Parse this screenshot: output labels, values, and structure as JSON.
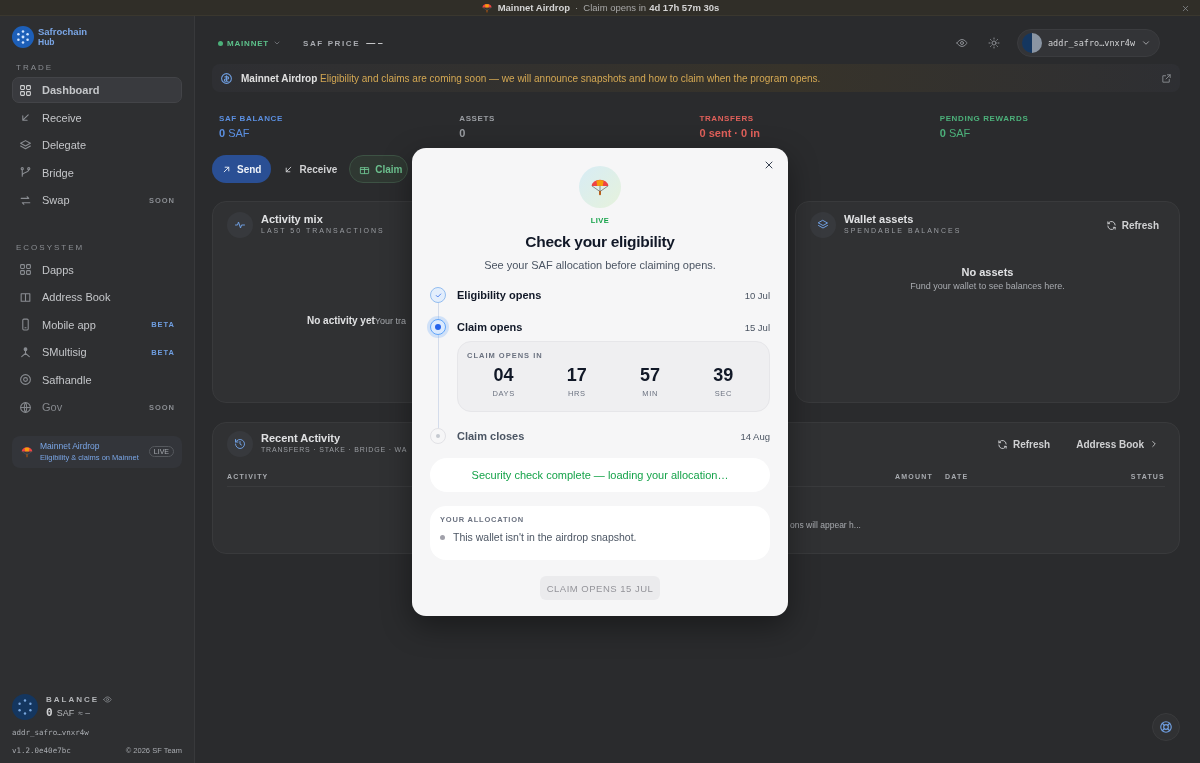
{
  "top_banner": {
    "title": "Mainnet Airdrop",
    "separator": "·",
    "label": "Claim opens in",
    "countdown": "4d 17h 57m 30s"
  },
  "sidebar": {
    "logo": {
      "name": "Safrochain",
      "sub": "Hub"
    },
    "sections": [
      {
        "title": "TRADE",
        "items": [
          {
            "label": "Dashboard",
            "selected": true,
            "disabled": false
          },
          {
            "label": "Receive",
            "selected": false,
            "disabled": false
          },
          {
            "label": "Delegate",
            "selected": false,
            "disabled": false
          },
          {
            "label": "Bridge",
            "selected": false,
            "disabled": false
          },
          {
            "label": "Swap",
            "selected": false,
            "disabled": false,
            "badge": {
              "text": "SOON",
              "kind": "soon"
            }
          }
        ]
      },
      {
        "title": "ECOSYSTEM",
        "items": [
          {
            "label": "Dapps",
            "selected": false,
            "disabled": false
          },
          {
            "label": "Address Book",
            "selected": false,
            "disabled": false
          },
          {
            "label": "Mobile app",
            "selected": false,
            "disabled": false,
            "badge": {
              "text": "BETA",
              "kind": "beta"
            }
          },
          {
            "label": "SMultisig",
            "selected": false,
            "disabled": false,
            "badge": {
              "text": "BETA",
              "kind": "beta"
            }
          },
          {
            "label": "Safhandle",
            "selected": false,
            "disabled": false
          },
          {
            "label": "Gov",
            "selected": false,
            "disabled": true,
            "badge": {
              "text": "SOON",
              "kind": "soon"
            }
          }
        ]
      }
    ],
    "promo": {
      "title": "Mainnet Airdrop",
      "text": "Eligibility & claims on Mainnet",
      "badge": "LIVE"
    },
    "wallet": {
      "label": "BALANCE",
      "amount": "0",
      "unit": "SAF",
      "fiat": "≈ –",
      "address": "addr_safro…vnxr4w"
    },
    "footer": {
      "version": "v1.2.0e40e7bc",
      "copyright": "© 2026 SF Team"
    }
  },
  "header": {
    "network": "MAINNET",
    "price_label": "SAF PRICE",
    "price_value": "— –",
    "account": "addr_safro…vnxr4w"
  },
  "notice": {
    "title": "Mainnet Airdrop",
    "text": "Eligibility and claims are coming soon — we will announce snapshots and how to claim when the program opens."
  },
  "stats": [
    {
      "label": "SAF BALANCE",
      "value": "0",
      "unit": "SAF",
      "color": "#5b8fe0"
    },
    {
      "label": "ASSETS",
      "value": "0",
      "color": "#9a9da2"
    },
    {
      "label": "TRANSFERS",
      "value": "0 sent · 0 in",
      "color": "#e0605a"
    },
    {
      "label": "PENDING REWARDS",
      "value": "0",
      "unit": "SAF",
      "color": "#4cb07a"
    }
  ],
  "actions": [
    {
      "label": "Send",
      "kind": "primary"
    },
    {
      "label": "Receive",
      "kind": "plain"
    },
    {
      "label": "Claim",
      "kind": "claim"
    }
  ],
  "activity_mix": {
    "title": "Activity mix",
    "subtitle": "LAST 50 TRANSACTIONS",
    "empty_title": "No activity yet",
    "empty_text": "Your tra"
  },
  "wallet_assets": {
    "title": "Wallet assets",
    "subtitle": "SPENDABLE BALANCES",
    "refresh": "Refresh",
    "empty_title": "No assets",
    "empty_text": "Fund your wallet to see balances here."
  },
  "recent_activity": {
    "title": "Recent Activity",
    "subtitle": "TRANSFERS · STAKE · BRIDGE · WA",
    "refresh": "Refresh",
    "link": "Address Book",
    "columns": [
      "ACTIVITY",
      "AMOUNT",
      "DATE",
      "STATUS"
    ],
    "empty_text": "ons will appear h..."
  },
  "modal": {
    "badge": "LIVE",
    "title": "Check your eligibility",
    "subtitle": "See your SAF allocation before claiming opens.",
    "steps": [
      {
        "label": "Eligibility opens",
        "date": "10 Jul",
        "kind": "done"
      },
      {
        "label": "Claim opens",
        "date": "15 Jul",
        "kind": "current"
      },
      {
        "label": "Claim closes",
        "date": "14 Aug",
        "kind": "upcoming"
      }
    ],
    "countdown": {
      "label": "CLAIM OPENS IN",
      "units": [
        {
          "value": "04",
          "unit": "DAYS"
        },
        {
          "value": "17",
          "unit": "HRS"
        },
        {
          "value": "57",
          "unit": "MIN"
        },
        {
          "value": "39",
          "unit": "SEC"
        }
      ]
    },
    "security": "Security check complete — loading your allocation…",
    "allocation": {
      "label": "YOUR ALLOCATION",
      "text": "This wallet isn't in the airdrop snapshot."
    },
    "claim_button": {
      "label": "CLAIM OPENS 15 JUL",
      "disabled": true
    }
  }
}
